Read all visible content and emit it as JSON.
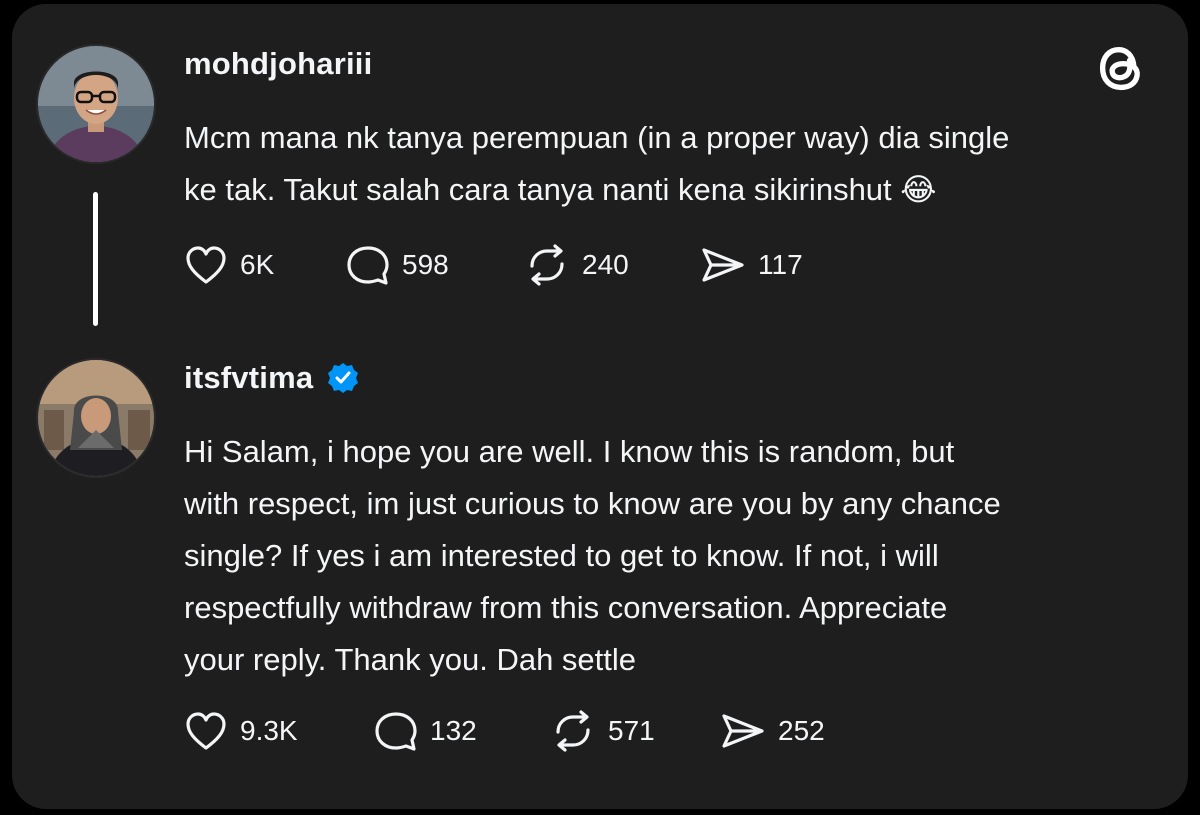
{
  "posts": [
    {
      "username": "mohdjohariii",
      "verified": false,
      "text": "Mcm mana nk tanya perempuan (in a proper way) dia single\nke tak. Takut salah cara tanya nanti kena sikirinshut 😂",
      "likes": "6K",
      "replies": "598",
      "reposts": "240",
      "shares": "117"
    },
    {
      "username": "itsfvtima",
      "verified": true,
      "text": "Hi Salam, i hope you are well. I know this is random, but\nwith respect, im just curious to know are you by any chance\nsingle? If yes i am interested to get to know. If not, i will\nrespectfully withdraw from this conversation. Appreciate\nyour reply. Thank you. Dah settle",
      "likes": "9.3K",
      "replies": "132",
      "reposts": "571",
      "shares": "252"
    }
  ],
  "colors": {
    "background": "#000000",
    "card": "#1e1e1e",
    "text": "#f3f5f7",
    "verified": "#0095f6"
  },
  "icons": {
    "logo": "threads-logo-icon",
    "like": "heart-icon",
    "reply": "comment-bubble-icon",
    "repost": "repost-icon",
    "share": "send-icon",
    "verified": "verified-badge-icon"
  }
}
